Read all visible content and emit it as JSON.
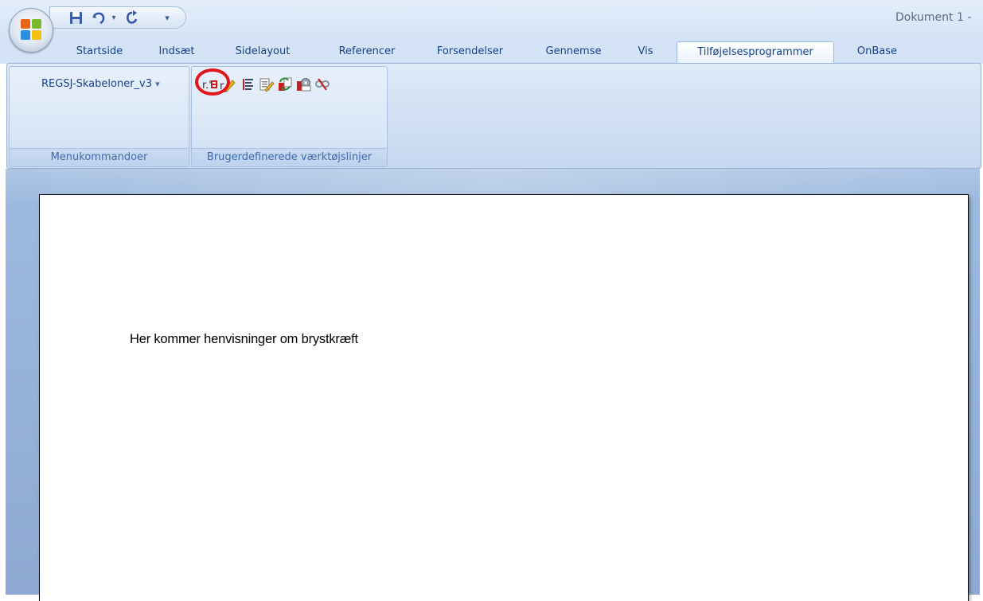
{
  "window": {
    "title": "Dokument 1 -"
  },
  "quick_access": {
    "items": [
      "save-icon",
      "undo-icon",
      "undo-dropdown-icon",
      "redo-icon",
      "customize-dropdown-icon"
    ]
  },
  "tabs": [
    {
      "label": "Startside"
    },
    {
      "label": "Indsæt"
    },
    {
      "label": "Sidelayout"
    },
    {
      "label": "Referencer"
    },
    {
      "label": "Forsendelser"
    },
    {
      "label": "Gennemse"
    },
    {
      "label": "Vis"
    },
    {
      "label": "Tilføjelsesprogrammer"
    },
    {
      "label": "OnBase"
    }
  ],
  "active_tab": "Tilføjelsesprogrammer",
  "ribbon": {
    "menu_group": {
      "label": "Menukommandoer",
      "dropdown_label": "REGSJ-Skabeloner_v3",
      "dropdown_arrow": "▾"
    },
    "toolbar_group": {
      "label": "Brugerdefinerede værktøjslinjer",
      "icons": [
        "insert-field-icon",
        "edit-pencil-icon",
        "align-list-icon",
        "edit-doc-icon",
        "refresh-doc-icon",
        "settings-doc-icon",
        "unlink-icon"
      ]
    }
  },
  "document": {
    "body_text": "Her kommer henvisninger om brystkræft"
  },
  "colors": {
    "highlight": "#e0161c",
    "ribbon_text": "#15428b",
    "ribbon_bg": "#d5e3f6"
  }
}
